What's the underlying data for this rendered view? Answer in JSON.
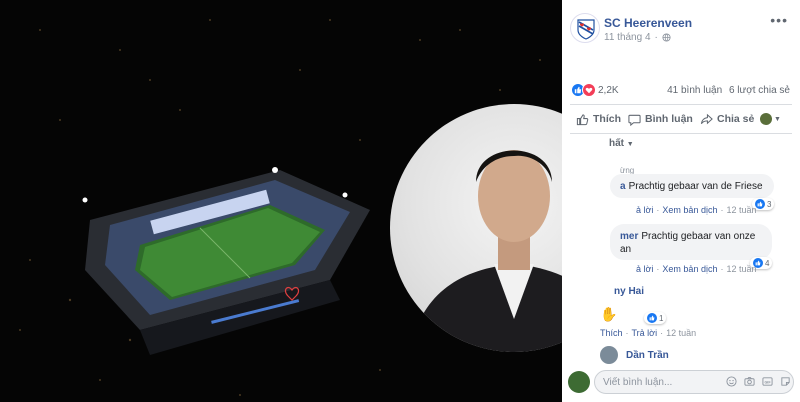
{
  "post": {
    "page_name": "SC Heerenveen",
    "date": "11 tháng 4",
    "reaction_count": "2,2K",
    "comments_count": "41 bình luận",
    "shares_count": "6 lượt chia sẻ"
  },
  "actions": {
    "like": "Thích",
    "comment": "Bình luận",
    "share": "Chia sẻ"
  },
  "sort": {
    "label": "hất"
  },
  "comments": [
    {
      "top_label": "ừng",
      "author": "a",
      "text": "Prachtig gebaar van de Friese",
      "likes": "3",
      "reply": "ả lời",
      "translate": "Xem bản dịch",
      "time": "12 tuần"
    },
    {
      "author": "mer",
      "text": "Prachtig gebaar van onze",
      "text2": "an",
      "likes": "4",
      "reply": "ả lời",
      "translate": "Xem bản dịch",
      "time": "12 tuần"
    },
    {
      "author": "ny Hai",
      "likes": "1",
      "like": "Thích",
      "reply": "Trả lời",
      "time": "12 tuần"
    }
  ],
  "next_comment": {
    "author": "Dần Trần"
  },
  "comment_box": {
    "placeholder": "Viết bình luận..."
  },
  "colors": {
    "link": "#385898",
    "like_blue": "#1877f2",
    "love_red": "#f33e58",
    "muted": "#606770"
  }
}
